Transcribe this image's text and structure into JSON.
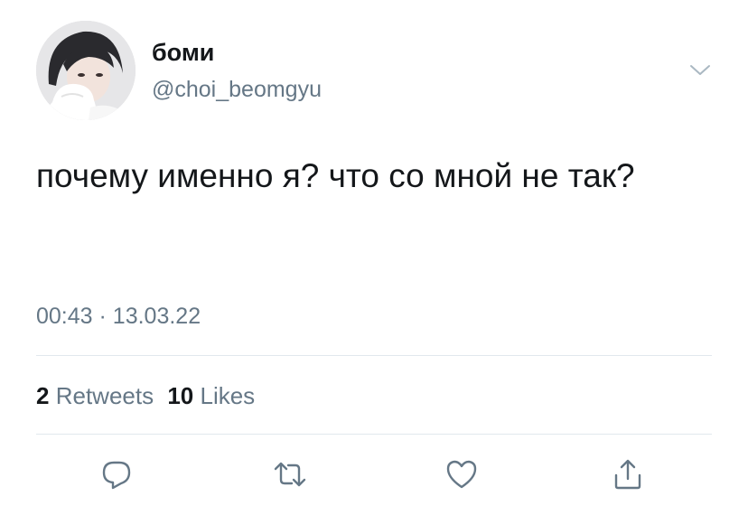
{
  "author": {
    "display_name": "боми",
    "handle": "@choi_beomgyu",
    "avatar_icon": "profile-photo"
  },
  "tweet": {
    "text": "почему именно я? что со мной не так?",
    "time": "00:43",
    "separator": "·",
    "date": "13.03.22"
  },
  "stats": {
    "retweets_count": "2",
    "retweets_label": "Retweets",
    "likes_count": "10",
    "likes_label": "Likes"
  },
  "actions": [
    {
      "name": "reply",
      "icon": "comment-icon"
    },
    {
      "name": "retweet",
      "icon": "retweet-icon"
    },
    {
      "name": "like",
      "icon": "heart-icon"
    },
    {
      "name": "share",
      "icon": "share-icon"
    }
  ],
  "colors": {
    "primary_text": "#14171a",
    "secondary_text": "#657786",
    "divider": "#e1e8ed",
    "icon": "#657786"
  }
}
